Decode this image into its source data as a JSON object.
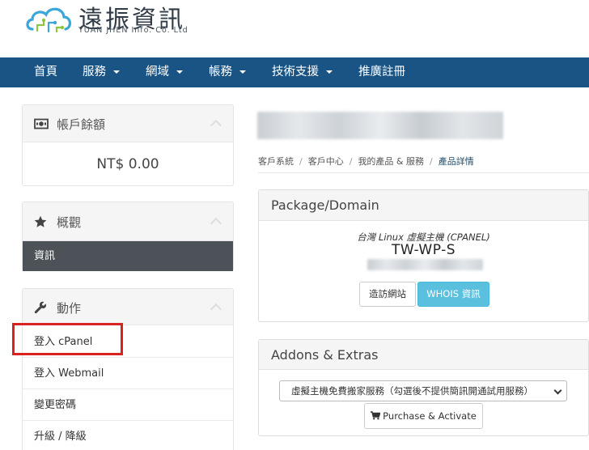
{
  "logo": {
    "title": "遠振資訊",
    "subtitle": "YUAN JHEN Info. Co. Ltd",
    "icon": "cloud-circuit-logo"
  },
  "nav": {
    "items": [
      {
        "label": "首頁",
        "dropdown": false
      },
      {
        "label": "服務",
        "dropdown": true
      },
      {
        "label": "網域",
        "dropdown": true
      },
      {
        "label": "帳務",
        "dropdown": true
      },
      {
        "label": "技術支援",
        "dropdown": true
      },
      {
        "label": "推廣註冊",
        "dropdown": false
      }
    ],
    "color": "#1a5485"
  },
  "sidebar": {
    "balance": {
      "title": "帳戶餘額",
      "icon": "money-icon",
      "value": "NT$ 0.00"
    },
    "overview": {
      "title": "概觀",
      "icon": "star-icon",
      "active_item": "資訊"
    },
    "actions": {
      "title": "動作",
      "icon": "wrench-icon",
      "items": [
        "登入 cPanel",
        "登入 Webmail",
        "變更密碼",
        "升級 / 降級"
      ]
    }
  },
  "breadcrumb": [
    "客戶系統",
    "客戶中心",
    "我的產品 & 服務",
    "產品詳情"
  ],
  "package": {
    "title": "Package/Domain",
    "product_group": "台灣 Linux 虛擬主機 (CPANEL)",
    "product_name": "TW-WP-S",
    "visit_button": "造訪網站",
    "whois_button": "WHOIS 資訊"
  },
  "addons": {
    "title": "Addons & Extras",
    "selected_option": "虛擬主機免費搬家服務（勾選後不提供簡訊開通試用服務）",
    "purchase_button": "Purchase & Activate"
  },
  "colors": {
    "highlight_box": "#d9211f",
    "whois_button": "#5bc0de",
    "active_sidebar": "#4c5257"
  }
}
